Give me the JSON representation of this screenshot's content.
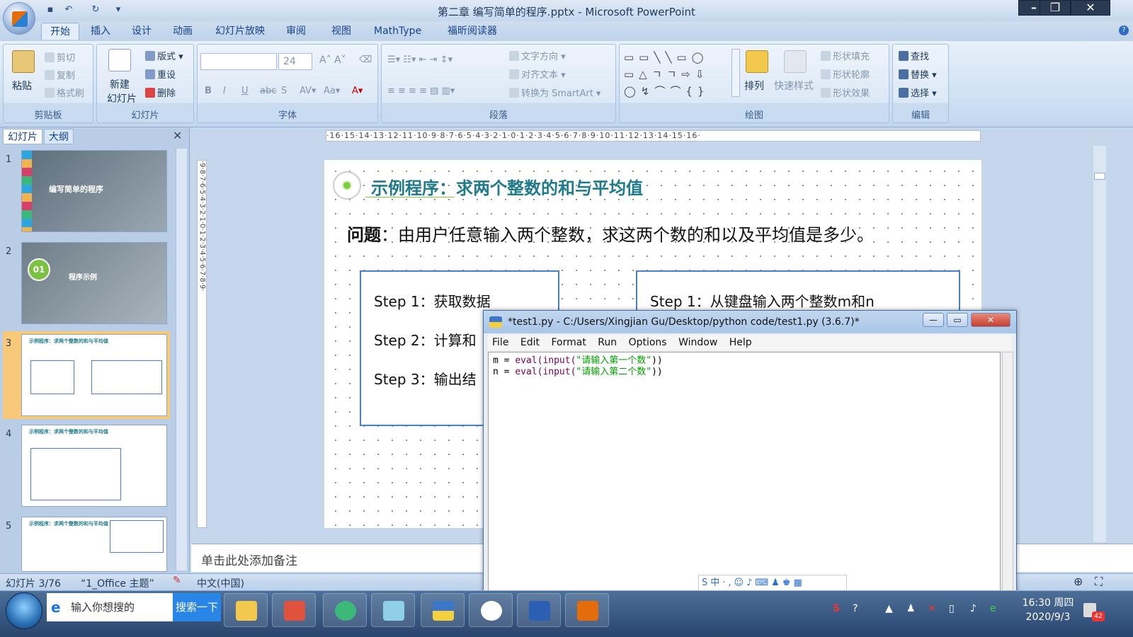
{
  "window": {
    "title": "第二章 编写简单的程序.pptx - Microsoft PowerPoint"
  },
  "ribbon_tabs": [
    "开始",
    "插入",
    "设计",
    "动画",
    "幻灯片放映",
    "审阅",
    "视图",
    "MathType",
    "福昕阅读器"
  ],
  "ribbon": {
    "clipboard": {
      "label": "剪贴板",
      "paste": "粘贴",
      "cut": "剪切",
      "copy": "复制",
      "format_painter": "格式刷"
    },
    "slides": {
      "label": "幻灯片",
      "new_slide_1": "新建",
      "new_slide_2": "幻灯片",
      "layout": "版式",
      "reset": "重设",
      "delete": "删除"
    },
    "font": {
      "label": "字体",
      "size": "24"
    },
    "paragraph": {
      "label": "段落",
      "text_direction": "文字方向",
      "align_text": "对齐文本",
      "smartart": "转换为 SmartArt"
    },
    "drawing": {
      "label": "绘图",
      "arrange": "排列",
      "quick_styles": "快速样式",
      "shape_fill": "形状填充",
      "shape_outline": "形状轮廓",
      "shape_effects": "形状效果"
    },
    "editing": {
      "label": "编辑",
      "find": "查找",
      "replace": "替换",
      "select": "选择"
    }
  },
  "panel": {
    "tab_slides": "幻灯片",
    "tab_outline": "大纲",
    "thumbs": [
      {
        "num": "1",
        "text": "编写简单的程序"
      },
      {
        "num": "2",
        "text": "程序示例",
        "badge": "01"
      },
      {
        "num": "3",
        "text": "示例程序：求两个整数的和与平均值"
      },
      {
        "num": "4",
        "text": "示例程序：求两个整数的和与平均值"
      },
      {
        "num": "5",
        "text": "示例程序：求两个整数的和与平均值"
      }
    ]
  },
  "rulers": {
    "horizontal": "·16·15·14·13·12·11·10·9·8·7·6·5·4·3·2·1·0·1·2·3·4·5·6·7·8·9·10·11·12·13·14·15·16·",
    "vertical": "·9·8·7·6·5·4·3·2·1·0·1·2·3·4·5·6·7·8·9·"
  },
  "slide": {
    "title": "示例程序：求两个整数的和与平均值",
    "question_label": "问题",
    "question_text": "：由用户任意输入两个整数，求这两个数的和以及平均值是多少。",
    "left_steps": [
      "Step 1：获取数据",
      "Step 2：计算和",
      "Step 3：输出结"
    ],
    "right_steps": [
      "Step 1：从键盘输入两个整数m和n"
    ]
  },
  "notes": {
    "placeholder": "单击此处添加备注"
  },
  "status": {
    "slide": "幻灯片 3/76",
    "theme": "“1_Office 主题”",
    "language": "中文(中国)"
  },
  "idle": {
    "title": "*test1.py - C:/Users/Xingjian Gu/Desktop/python code/test1.py (3.6.7)*",
    "menu": [
      "File",
      "Edit",
      "Format",
      "Run",
      "Options",
      "Window",
      "Help"
    ],
    "code": [
      {
        "var": "m = ",
        "fn": "eval(input(",
        "str": "\"请输入第一个数\"",
        "end": "))"
      },
      {
        "var": "n = ",
        "fn": "eval(input(",
        "str": "\"请输入第二个数\"",
        "end": "))"
      }
    ],
    "ime": "S中·,☺♪⌨♟♚▦"
  },
  "taskbar": {
    "search_text": "输入你想搜的",
    "search_button": "搜索一下",
    "clock_time": "16:30 周四",
    "clock_date": "2020/9/3",
    "badge": "42"
  },
  "colors": {
    "accent": "#1f7a8c",
    "box_border": "#4a7ecf",
    "ribbon": "#dce8f6"
  }
}
